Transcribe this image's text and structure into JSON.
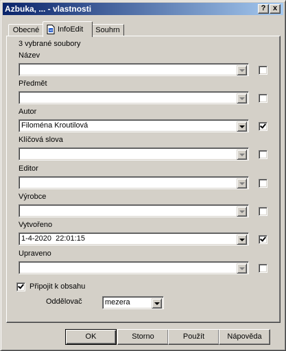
{
  "window": {
    "title": "Azbuka, ... - vlastnosti"
  },
  "title_buttons": {
    "help": "?",
    "close": "x"
  },
  "tabs": [
    {
      "label": "Obecné",
      "active": false
    },
    {
      "label": "InfoEdit",
      "active": true
    },
    {
      "label": "Souhrn",
      "active": false
    }
  ],
  "panel": {
    "selection_info": "3 vybrané soubory",
    "fields": [
      {
        "label": "Název",
        "value": "",
        "checked": false
      },
      {
        "label": "Předmět",
        "value": "",
        "checked": false
      },
      {
        "label": "Autor",
        "value": "Filoména Kroutilová",
        "checked": true
      },
      {
        "label": "Klíčová slova",
        "value": "",
        "checked": false
      },
      {
        "label": "Editor",
        "value": "",
        "checked": false
      },
      {
        "label": "Výrobce",
        "value": "",
        "checked": false
      },
      {
        "label": "Vytvořeno",
        "value": "1-4-2020  22:01:15",
        "checked": true
      },
      {
        "label": "Upraveno",
        "value": "",
        "checked": false
      }
    ],
    "append_label": "Připojit k obsahu",
    "append_checked": true,
    "separator_label": "Oddělovač",
    "separator_value": "mezera"
  },
  "buttons": {
    "ok": "OK",
    "cancel": "Storno",
    "apply": "Použít",
    "help": "Nápověda"
  }
}
